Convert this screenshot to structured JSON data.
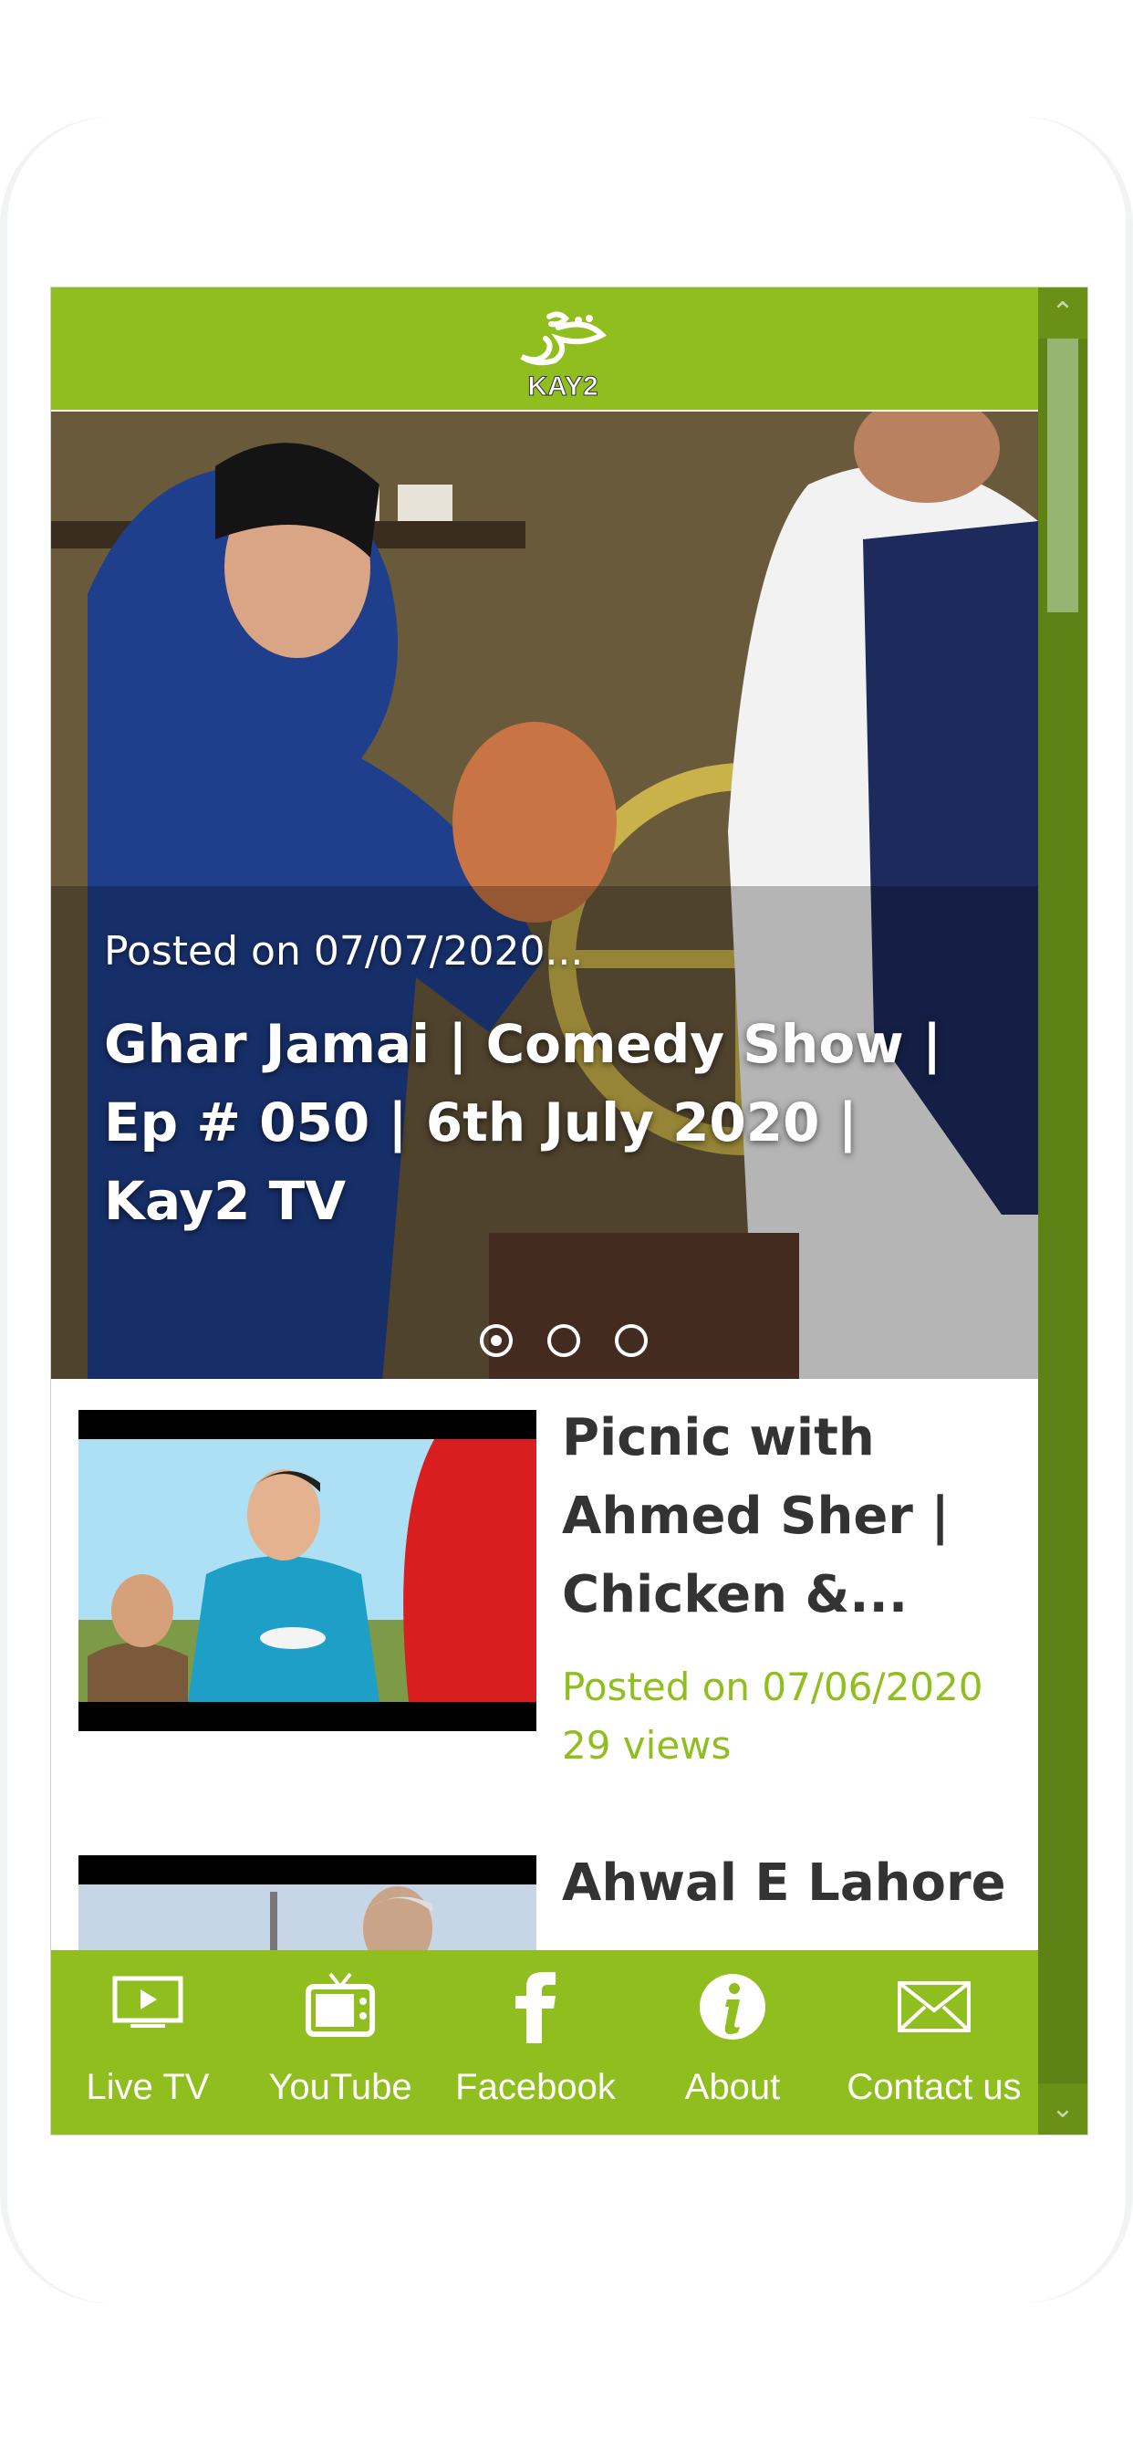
{
  "header": {
    "logo_text": "KAY2",
    "logo_alt": "Kay2 TV logo"
  },
  "hero": {
    "date": "Posted on 07/07/2020...",
    "title": "Ghar Jamai | Comedy Show | Ep # 050 | 6th July 2020 | Kay2 TV",
    "slides": 3,
    "active_slide": 1
  },
  "videos": [
    {
      "title": "Picnic with Ahmed Sher | Chicken &...",
      "date": "Posted on 07/06/2020",
      "views": "29 views"
    },
    {
      "title": "Ahwal E Lahore"
    }
  ],
  "nav": [
    {
      "label": "Live TV",
      "icon": "tv-play-icon"
    },
    {
      "label": "YouTube",
      "icon": "television-icon"
    },
    {
      "label": "Facebook",
      "icon": "facebook-icon"
    },
    {
      "label": "About",
      "icon": "info-icon"
    },
    {
      "label": "Contact us",
      "icon": "mail-icon"
    }
  ],
  "colors": {
    "brand": "#8fbe1e",
    "text": "#333333",
    "scrollbar": "#5f8216"
  }
}
